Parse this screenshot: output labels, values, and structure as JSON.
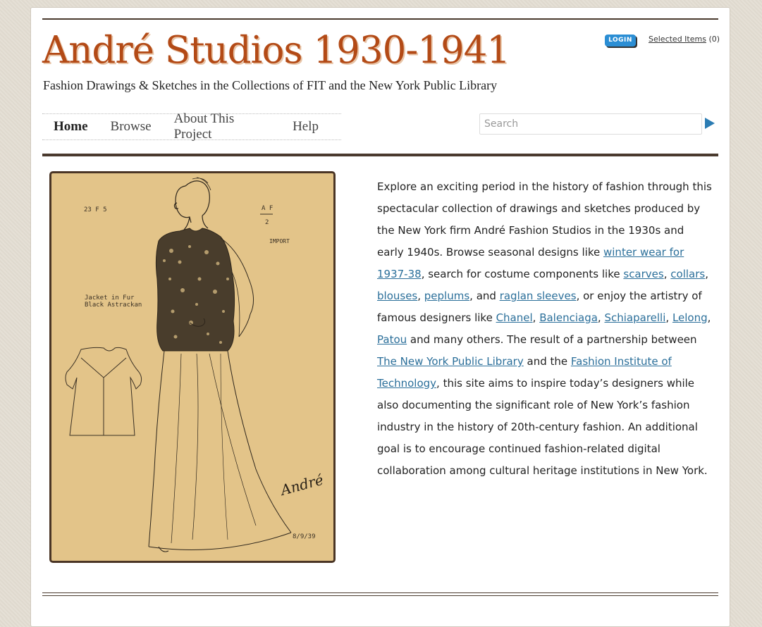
{
  "header": {
    "title": "André Studios 1930-1941",
    "subtitle": "Fashion Drawings & Sketches in the Collections of FIT and the New York Public Library",
    "login_label": "LOGIN",
    "selected_items_label": "Selected Items",
    "selected_items_count": "(0)"
  },
  "nav": {
    "items": [
      {
        "label": "Home"
      },
      {
        "label": "Browse"
      },
      {
        "label": "About This Project"
      },
      {
        "label": "Help"
      }
    ]
  },
  "search": {
    "placeholder": "Search"
  },
  "sketch": {
    "code_left": "23 F 5",
    "code_right_top": "A F",
    "code_right_bottom": "2",
    "import_label": "IMPORT",
    "caption_line1": "Jacket in Fur",
    "caption_line2": "Black Astrackan",
    "signature": "André",
    "date": "8/9/39"
  },
  "intro": {
    "t1": "Explore an exciting period in the history of fashion through this spectacular collection of drawings and sketches produced by the New York firm André Fashion Studios in the 1930s and early 1940s. Browse seasonal designs like ",
    "link_winter": "winter wear for 1937-38",
    "t2": ", search for costume components like ",
    "link_scarves": "scarves",
    "sep1": ", ",
    "link_collars": "collars",
    "sep2": ", ",
    "link_blouses": "blouses",
    "sep3": ", ",
    "link_peplums": "peplums",
    "t3": ", and ",
    "link_raglan": "raglan sleeves",
    "t4": ", or enjoy the artistry of famous designers like ",
    "link_chanel": "Chanel",
    "sep4": ", ",
    "link_balenciaga": "Balenciaga",
    "sep5": ", ",
    "link_schiaparelli": "Schiaparelli",
    "sep6": ", ",
    "link_lelong": "Lelong",
    "sep7": ", ",
    "link_patou": "Patou",
    "t5": " and many others. The result of a partnership between ",
    "link_nypl": "The New York Public Library",
    "t6": " and the ",
    "link_fit": "Fashion Institute of Technology",
    "t7": ", this site aims to inspire today’s designers while also documenting the significant role of New York’s fashion industry in the history of 20th-century fashion. An additional goal is to encourage continued fashion-related digital collaboration among cultural heritage institutions in New York."
  }
}
